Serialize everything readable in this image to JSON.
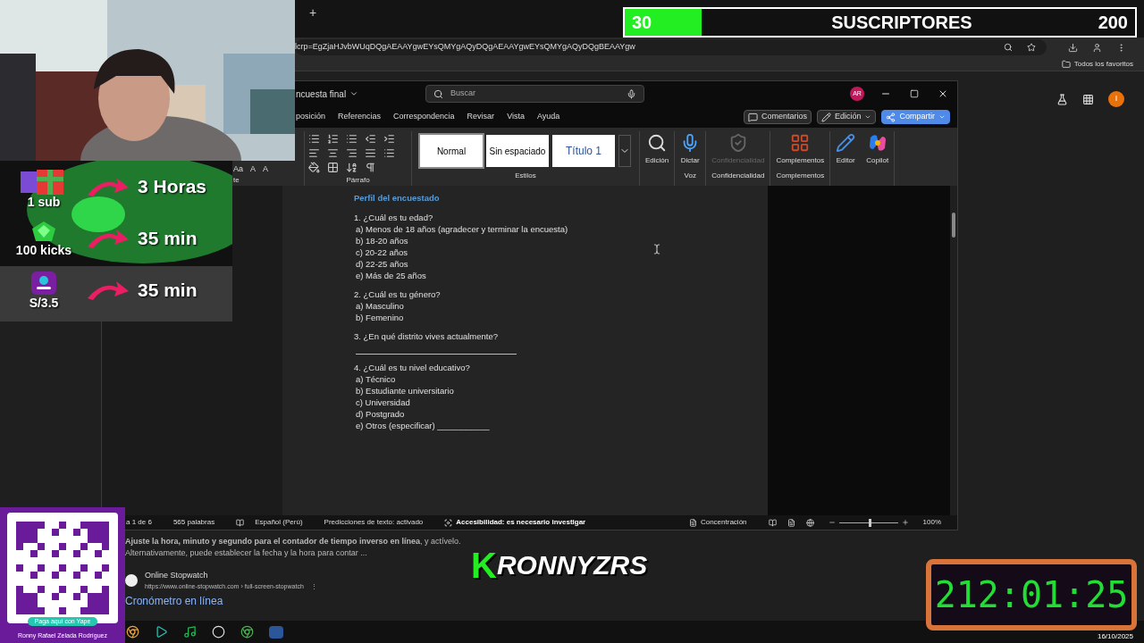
{
  "browser": {
    "new_tab": "+",
    "url": "lcrp=EgZjaHJvbWUqDQgAEAAYgwEYsQMYgAQyDQgAEAAYgwEYsQMYgAQyDQgBEAAYgw",
    "bookmarks_folder": "Todos los favoritos",
    "page_avatar": "I"
  },
  "word": {
    "doc_title": "ncuesta final",
    "search_placeholder": "Buscar",
    "user_initials": "AR",
    "tabs": [
      {
        "label": "posición",
        "selected": false
      },
      {
        "label": "Referencias",
        "selected": false
      },
      {
        "label": "Correspondencia",
        "selected": false
      },
      {
        "label": "Revisar",
        "selected": false
      },
      {
        "label": "Vista",
        "selected": false
      },
      {
        "label": "Ayuda",
        "selected": false
      }
    ],
    "actions": [
      {
        "label": "Comentarios",
        "kind": "comments"
      },
      {
        "label": "Edición",
        "kind": "editing"
      },
      {
        "label": "Compartir",
        "kind": "share"
      }
    ],
    "font_group_label": "te",
    "font_controls": [
      "Aa",
      "A",
      "A"
    ],
    "paragraph_label": "Párrafo",
    "styles": [
      {
        "label": "Normal",
        "selected": true
      },
      {
        "label": "Sin espaciado",
        "selected": false
      },
      {
        "label": "Título 1",
        "selected": false
      }
    ],
    "styles_label": "Estilos",
    "big_buttons": [
      {
        "label": "Edición",
        "kind": "search",
        "disabled": false
      },
      {
        "label": "Dictar",
        "kind": "mic",
        "disabled": false,
        "group": "Voz"
      },
      {
        "label": "Confidencialidad",
        "kind": "sensitivity",
        "disabled": true,
        "group": "Confidencialidad"
      },
      {
        "label": "Complementos",
        "kind": "addins",
        "disabled": false,
        "group": "Complementos"
      },
      {
        "label": "Editor",
        "kind": "editor",
        "disabled": false
      },
      {
        "label": "Copilot",
        "kind": "copilot",
        "disabled": false
      }
    ],
    "document": {
      "heading": "Perfil del encuestado",
      "questions": [
        {
          "question": "1. ¿Cuál es tu edad?",
          "options": [
            "a) Menos de 18 años (agradecer y terminar la encuesta)",
            "b) 18-20 años",
            "c) 20-22 años",
            "d) 22-25 años",
            "e) Más de 25 años"
          ],
          "fill_line": false
        },
        {
          "question": "2. ¿Cuál es tu género?",
          "options": [
            "a) Masculino",
            "b) Femenino"
          ],
          "fill_line": false
        },
        {
          "question": "3. ¿En qué distrito vives actualmente?",
          "fill_line": true
        },
        {
          "question": "4. ¿Cuál es tu nivel educativo?",
          "options": [
            "a) Técnico",
            "b) Estudiante universitario",
            "c) Universidad",
            "d) Postgrado",
            "e) Otros (especificar) ___________"
          ],
          "fill_line": false
        }
      ]
    },
    "status": {
      "page": "a 1 de 6",
      "words": "565 palabras",
      "language": "Español (Perú)",
      "predictions": "Predicciones de texto: activado",
      "accessibility": "Accesibilidad: es necesario investigar",
      "focus": "Concentración",
      "zoom": "100%",
      "zoom_slider": {
        "level": 0.5
      }
    }
  },
  "search_results": {
    "snippet_1": "**Ajuste la hora, minuto y segundo para el contador de tiempo inverso en línea**, y actívelo.",
    "snippet_2": "Alternativamente, puede establecer la fecha y la hora para contar ...",
    "site_name": "Online Stopwatch",
    "site_url": "https://www.online-stopwatch.com › full-screen-stopwatch",
    "more": "⋮",
    "result_title": "Cronómetro en línea"
  },
  "sub_goal": {
    "current": "30",
    "label": "SUSCRIPTORES",
    "goal": "200",
    "level": 0.15
  },
  "rewards": [
    {
      "trigger": "1 sub",
      "kind": "gift",
      "reward": "3 Horas"
    },
    {
      "trigger": "100 kicks",
      "kind": "gem",
      "reward": "35 min"
    },
    {
      "trigger": "S/3.5",
      "kind": "app",
      "reward": "35 min"
    }
  ],
  "qr_panel": {
    "button": "Paga aquí con Yape",
    "owner": "Ronny Rafael Zelada Rodríguez"
  },
  "logo": {
    "initial": "K",
    "rest": "RONNYZRS"
  },
  "timer": "212:01:25",
  "taskbar": {
    "date": "16/10/2025"
  }
}
